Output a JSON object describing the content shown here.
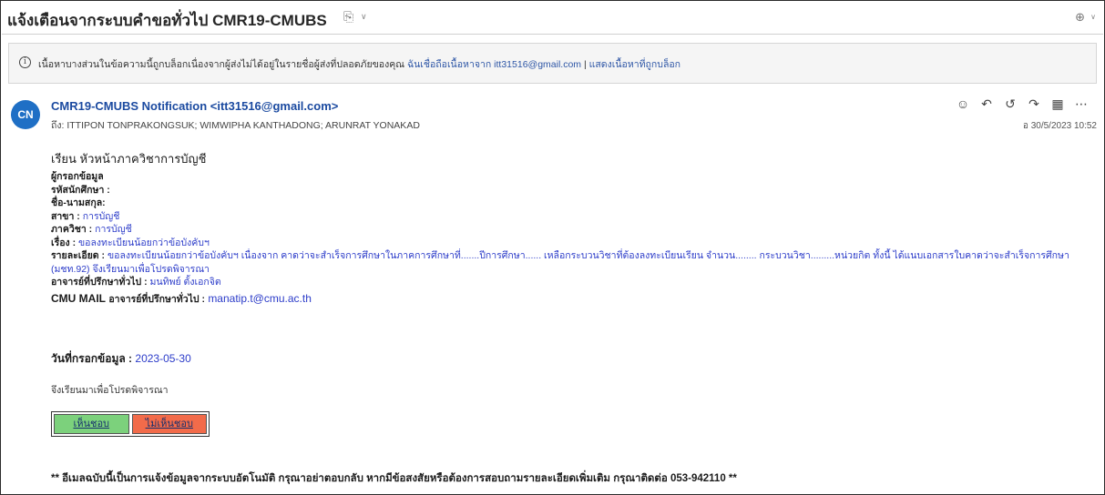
{
  "subject_bar": {
    "subject": "แจ้งเตือนจากระบบคำขอทั่วไป CMR19-CMUBS",
    "tag_icon": "tag-icon",
    "zoom_icon": "zoom-icon"
  },
  "info_bar": {
    "icon": "info-icon",
    "text": "เนื้อหาบางส่วนในข้อความนี้ถูกบล็อกเนื่องจากผู้ส่งไม่ได้อยู่ในรายชื่อผู้ส่งที่ปลอดภัยของคุณ",
    "trust_link": "ฉันเชื่อถือเนื้อหาจาก itt31516@gmail.com",
    "separator": "|",
    "show_link": "แสดงเนื้อหาที่ถูกบล็อก"
  },
  "message": {
    "avatar": "CN",
    "sender": "CMR19-CMUBS Notification <itt31516@gmail.com>",
    "to": "ถึง: ITTIPON TONPRAKONGSUK; WIMWIPHA KANTHADONG; ARUNRAT YONAKAD",
    "date": "อ 30/5/2023 10:52",
    "actions": [
      "smiley-icon",
      "reply-icon",
      "reply-all-icon",
      "forward-icon",
      "apps-icon",
      "more-icon"
    ]
  },
  "body": {
    "greeting": "เรียน หัวหน้าภาควิชาการบัญชี",
    "filler_heading": "ผู้กรอกข้อมูล",
    "student_id_label": "รหัสนักศึกษา :",
    "name_label": "ชื่อ-นามสกุล:",
    "major_label": "สาขา :",
    "major_value": "การบัญชี",
    "dept_label": "ภาควิชา :",
    "dept_value": "การบัญชี",
    "subject_label": "เรื่อง :",
    "subject_value": "ขอลงทะเบียนน้อยกว่าข้อบังคับฯ",
    "detail_label": "รายละเอียด :",
    "detail_value": "ขอลงทะเบียนน้อยกว่าข้อบังคับฯ เนื่องจาก คาดว่าจะสำเร็จการศึกษาในภาคการศึกษาที่.......ปีการศึกษา...... เหลือกระบวนวิชาที่ต้องลงทะเบียนเรียน จำนวน........ กระบวนวิชา.........หน่วยกิต ทั้งนี้ ได้แนบเอกสารใบคาดว่าจะสำเร็จการศึกษา (มชท.92) จึงเรียนมาเพื่อโปรดพิจารณา",
    "advisor_label": "อาจารย์ที่ปรึกษาทั่วไป :",
    "advisor_value": "มนทิพย์ ตั้งเอกจิต",
    "cmu_mail_label": "CMU MAIL",
    "cmu_mail_label2": "อาจารย์ที่ปรึกษาทั่วไป :",
    "cmu_mail_value": "manatip.t@cmu.ac.th",
    "date_label": "วันที่กรอกข้อมูล :",
    "date_value": "2023-05-30",
    "closing": "จึงเรียนมาเพื่อโปรดพิจารณา",
    "approve": "เห็นชอบ",
    "reject": "ไม่เห็นชอบ",
    "footer": "** อีเมลฉบับนี้เป็นการแจ้งข้อมูลจากระบบอัตโนมัติ กรุณาอย่าตอบกลับ หากมีข้อสงสัยหรือต้องการสอบถามรายละเอียดเพิ่มเติม กรุณาติดต่อ 053-942110 **"
  }
}
